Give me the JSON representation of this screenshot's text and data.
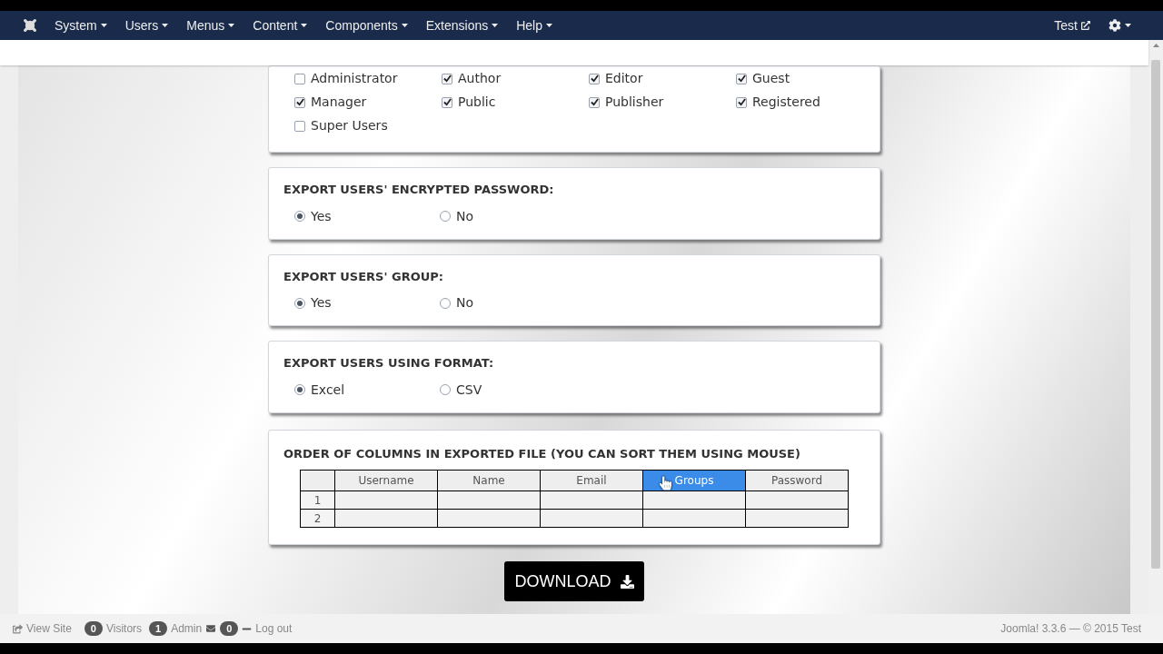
{
  "navbar": {
    "menus": [
      {
        "label": "System"
      },
      {
        "label": "Users"
      },
      {
        "label": "Menus"
      },
      {
        "label": "Content"
      },
      {
        "label": "Components"
      },
      {
        "label": "Extensions"
      },
      {
        "label": "Help"
      }
    ],
    "user": "Test"
  },
  "groups": [
    {
      "label": "Administrator",
      "checked": false
    },
    {
      "label": "Author",
      "checked": true
    },
    {
      "label": "Editor",
      "checked": true
    },
    {
      "label": "Guest",
      "checked": true
    },
    {
      "label": "Manager",
      "checked": true
    },
    {
      "label": "Public",
      "checked": true
    },
    {
      "label": "Publisher",
      "checked": true
    },
    {
      "label": "Registered",
      "checked": true
    },
    {
      "label": "Super Users",
      "checked": false
    }
  ],
  "options": [
    {
      "title": "EXPORT USERS' ENCRYPTED PASSWORD:",
      "choices": [
        {
          "label": "Yes",
          "selected": true
        },
        {
          "label": "No",
          "selected": false
        }
      ]
    },
    {
      "title": "EXPORT USERS' GROUP:",
      "choices": [
        {
          "label": "Yes",
          "selected": true
        },
        {
          "label": "No",
          "selected": false
        }
      ]
    },
    {
      "title": "EXPORT USERS USING FORMAT:",
      "choices": [
        {
          "label": "Excel",
          "selected": true
        },
        {
          "label": "CSV",
          "selected": false
        }
      ]
    }
  ],
  "order": {
    "title": "ORDER OF COLUMNS IN EXPORTED FILE (YOU CAN SORT THEM USING MOUSE)",
    "columns": [
      {
        "label": "Username",
        "selected": false
      },
      {
        "label": "Name",
        "selected": false
      },
      {
        "label": "Email",
        "selected": false
      },
      {
        "label": "Groups",
        "selected": true
      },
      {
        "label": "Password",
        "selected": false
      }
    ],
    "rows": [
      "1",
      "2"
    ]
  },
  "download": "DOWNLOAD",
  "status_bar": {
    "view_site": "View Site",
    "visitors_count": "0",
    "visitors": "Visitors",
    "admin_count": "1",
    "admin": "Admin",
    "messages_count": "0",
    "logout": "Log out",
    "version": "Joomla! 3.3.6 — © 2015 Test"
  }
}
